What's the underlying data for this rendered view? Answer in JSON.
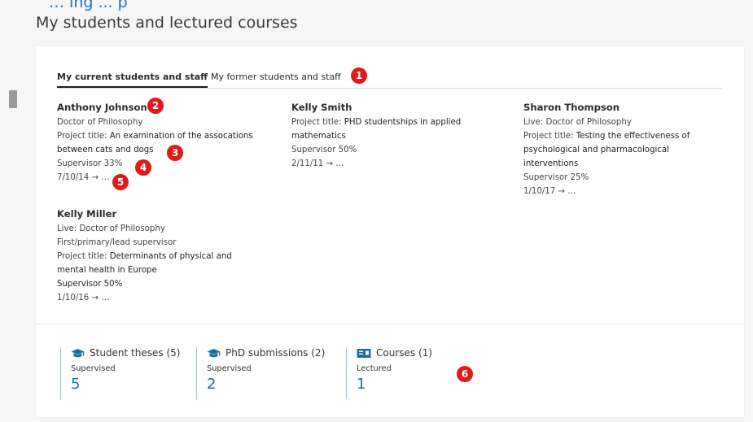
{
  "header": {
    "top_link": "… ing ... p",
    "title": "My students and lectured courses"
  },
  "tabs": {
    "current": "My current students and staff",
    "former": "My former students and staff"
  },
  "students": [
    {
      "name": "Anthony Johnson",
      "lines": [
        {
          "label": "Doctor of Philosophy",
          "value": ""
        },
        {
          "label": "Project title: ",
          "value": "An examination of the assocations"
        },
        {
          "label": "",
          "value": "between cats and dogs"
        },
        {
          "label": "Supervisor 33%",
          "value": ""
        },
        {
          "label": "7/10/14 → …",
          "value": ""
        }
      ]
    },
    {
      "name": "Kelly Smith",
      "lines": [
        {
          "label": "Project title: ",
          "value": "PHD studentships in applied"
        },
        {
          "label": "",
          "value": "mathematics"
        },
        {
          "label": "Supervisor 50%",
          "value": ""
        },
        {
          "label": "2/11/11 → …",
          "value": ""
        }
      ]
    },
    {
      "name": "Sharon Thompson",
      "lines": [
        {
          "label": "Live: Doctor of Philosophy",
          "value": ""
        },
        {
          "label": "Project title: ",
          "value": "Testing the effectiveness of"
        },
        {
          "label": "",
          "value": "psychological and pharmacological"
        },
        {
          "label": "",
          "value": "interventions"
        },
        {
          "label": "Supervisor 25%",
          "value": ""
        },
        {
          "label": "1/10/17 → …",
          "value": ""
        }
      ]
    },
    {
      "name": "Kelly Miller",
      "lines": [
        {
          "label": "Live: Doctor of Philosophy",
          "value": ""
        },
        {
          "label": "First/primary/lead supervisor",
          "value": ""
        },
        {
          "label": "Project title: ",
          "value": "Determinants of physical and"
        },
        {
          "label": "",
          "value": "mental health in Europe"
        },
        {
          "label": "",
          "value": "Supervisor 50%"
        },
        {
          "label": "1/10/16 → …",
          "value": ""
        }
      ]
    }
  ],
  "stats": [
    {
      "icon": "graduation-cap-icon",
      "title": "Student theses (5)",
      "sub": "Supervised",
      "count": "5"
    },
    {
      "icon": "graduation-cap-icon",
      "title": "PhD submissions (2)",
      "sub": "Supervised",
      "count": "2"
    },
    {
      "icon": "course-board-icon",
      "title": "Courses (1)",
      "sub": "Lectured",
      "count": "1"
    }
  ],
  "badges": [
    "1",
    "2",
    "3",
    "4",
    "5",
    "6"
  ],
  "colors": {
    "accent": "#1b6fa3",
    "badge": "#e31818",
    "icon": "#1a6e9e"
  }
}
